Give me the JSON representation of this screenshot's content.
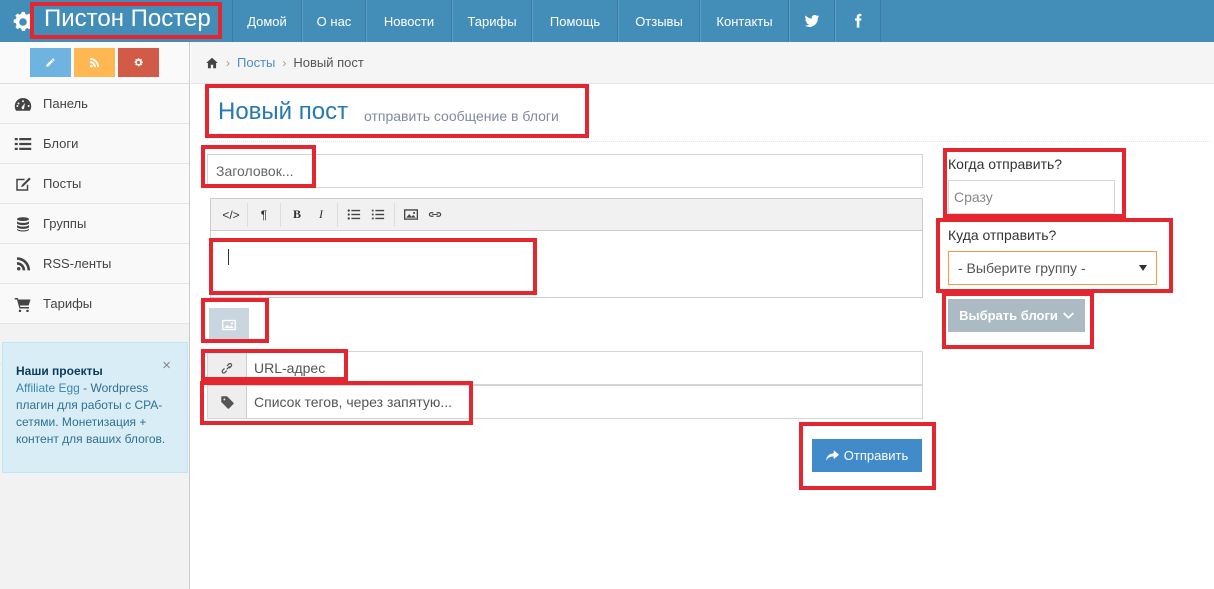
{
  "brand": {
    "name": "Пистон Постер"
  },
  "nav": {
    "items": [
      "Домой",
      "О нас",
      "Новости",
      "Тарифы",
      "Помощь",
      "Отзывы",
      "Контакты"
    ],
    "social": [
      "twitter-icon",
      "facebook-icon"
    ]
  },
  "shortcuts": [
    {
      "icon": "pencil-icon",
      "color": "#6fb3e0"
    },
    {
      "icon": "rss-icon",
      "color": "#ffb752"
    },
    {
      "icon": "gear-icon",
      "color": "#d15b47"
    }
  ],
  "sidebar": {
    "items": [
      {
        "label": "Панель",
        "icon": "dashboard-icon"
      },
      {
        "label": "Блоги",
        "icon": "list-icon"
      },
      {
        "label": "Посты",
        "icon": "edit-icon"
      },
      {
        "label": "Группы",
        "icon": "database-icon"
      },
      {
        "label": "RSS-ленты",
        "icon": "rss-icon"
      },
      {
        "label": "Тарифы",
        "icon": "cart-icon"
      }
    ]
  },
  "projects": {
    "title": "Наши проекты",
    "link": "Affiliate Egg",
    "text": " - Wordpress плагин для работы с CPA-сетями. Монетизация + контент для ваших блогов.",
    "close": "×"
  },
  "breadcrumb": {
    "items": [
      "Посты"
    ],
    "current": "Новый пост",
    "separator": "›"
  },
  "page": {
    "title": "Новый пост",
    "subtitle": "отправить сообщение в блоги"
  },
  "form": {
    "title_placeholder": "Заголовок...",
    "toolbar": {
      "code": "</>",
      "paragraph": "¶",
      "bold": "B",
      "italic": "I"
    },
    "url_placeholder": "URL-адрес",
    "tags_placeholder": "Список тегов, через запятую...",
    "submit_label": "Отправить"
  },
  "schedule": {
    "when_label": "Когда отправить?",
    "when_placeholder": "Сразу",
    "where_label": "Куда отправить?",
    "group_selected": "- Выберите группу -",
    "blogs_button": "Выбрать блоги"
  },
  "colors": {
    "navbar": "#438eb9",
    "title": "#2679b5",
    "submit": "#428bca",
    "highlight": "#e32630"
  }
}
